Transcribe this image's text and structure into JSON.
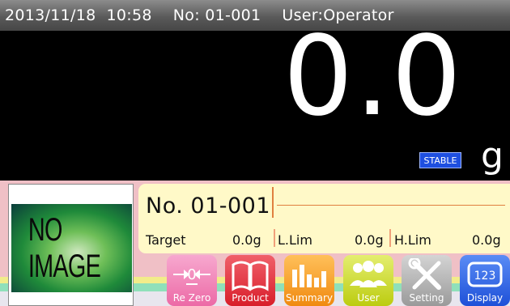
{
  "status": {
    "date": "2013/11/18",
    "time": "10:58",
    "number": "No: 01-001",
    "user": "User:Operator"
  },
  "weight": {
    "value": "0.0",
    "unit": "g",
    "stable_label": "STABLE"
  },
  "product": {
    "image_placeholder": "NO IMAGE",
    "number": "No. 01-001",
    "target_label": "Target",
    "target_value": "0.0g",
    "llim_label": "L.Lim",
    "llim_value": "0.0g",
    "hlim_label": "H.Lim",
    "hlim_value": "0.0g"
  },
  "toolbar": [
    {
      "label": "Re Zero",
      "icon": "rezero-icon",
      "color": "#f07ab0"
    },
    {
      "label": "Product",
      "icon": "book-icon",
      "color": "#e8303a"
    },
    {
      "label": "Summary",
      "icon": "bar-chart-icon",
      "color": "#f5a020"
    },
    {
      "label": "User",
      "icon": "users-icon",
      "color": "#c8d820"
    },
    {
      "label": "Setting",
      "icon": "wrench-screwdriver-icon",
      "color": "#a8a8a8"
    },
    {
      "label": "Display",
      "icon": "display-123-icon",
      "color": "#2a62e0"
    }
  ],
  "colors": {
    "stable_badge": "#1e4fe0",
    "info_panel": "#fff9c8",
    "lower_panel": "#f0c0c6",
    "accent_line": "#e08040"
  }
}
